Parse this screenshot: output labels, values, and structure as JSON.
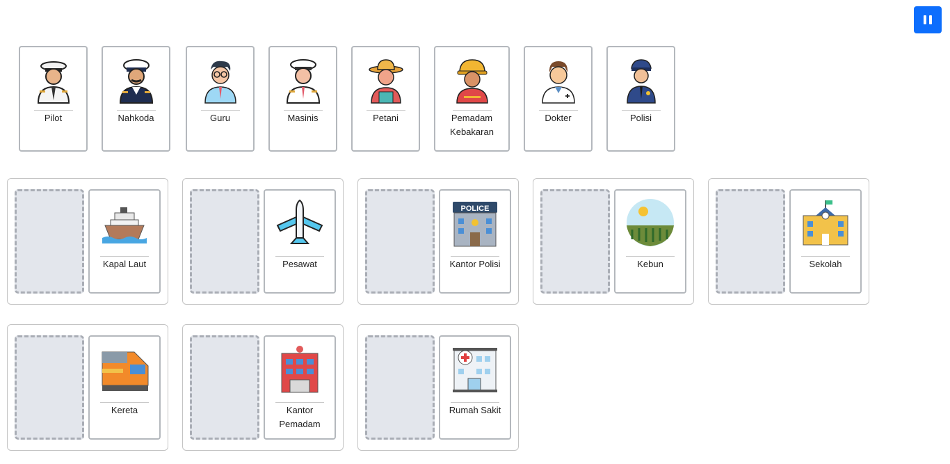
{
  "controls": {
    "pause": "pause-icon"
  },
  "professions": [
    {
      "label": "Pilot",
      "icon": "pilot-icon"
    },
    {
      "label": "Nahkoda",
      "icon": "ship-captain-icon"
    },
    {
      "label": "Guru",
      "icon": "teacher-icon"
    },
    {
      "label": "Masinis",
      "icon": "train-driver-icon"
    },
    {
      "label": "Petani",
      "icon": "farmer-icon"
    },
    {
      "label": "Pemadam Kebakaran",
      "icon": "firefighter-icon"
    },
    {
      "label": "Dokter",
      "icon": "doctor-icon"
    },
    {
      "label": "Polisi",
      "icon": "police-officer-icon"
    }
  ],
  "places": [
    {
      "label": "Kapal Laut",
      "icon": "ship-icon"
    },
    {
      "label": "Pesawat",
      "icon": "airplane-icon"
    },
    {
      "label": "Kantor Polisi",
      "icon": "police-station-icon",
      "sign": "POLICE"
    },
    {
      "label": "Kebun",
      "icon": "garden-icon"
    },
    {
      "label": "Sekolah",
      "icon": "school-icon"
    },
    {
      "label": "Kereta",
      "icon": "train-icon"
    },
    {
      "label": "Kantor Pemadam",
      "icon": "fire-station-icon"
    },
    {
      "label": "Rumah Sakit",
      "icon": "hospital-icon"
    }
  ]
}
